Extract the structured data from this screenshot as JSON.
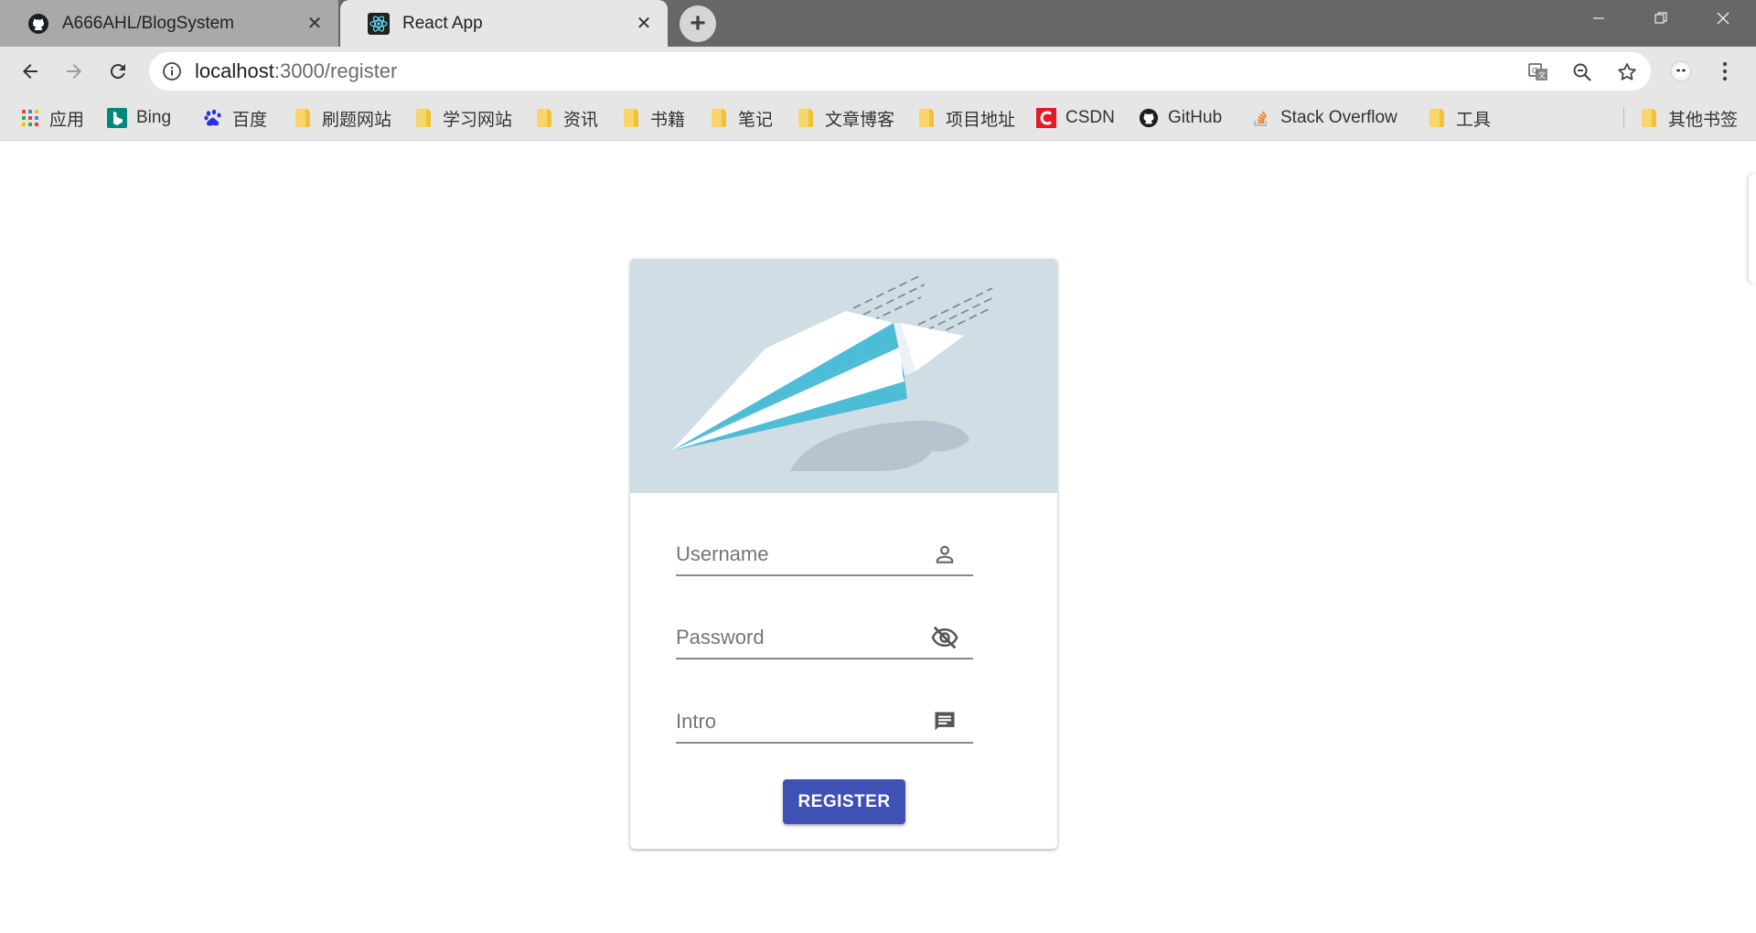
{
  "browser": {
    "tabs": [
      {
        "title": "A666AHL/BlogSystem",
        "favicon": "github-icon",
        "active": false
      },
      {
        "title": "React App",
        "favicon": "react-icon",
        "active": true
      }
    ],
    "url": {
      "host": "localhost",
      "path": ":3000/register"
    },
    "bookmarks": [
      {
        "label": "应用",
        "icon": "apps-grid-icon"
      },
      {
        "label": "Bing",
        "icon": "bing-icon"
      },
      {
        "label": "百度",
        "icon": "baidu-icon"
      },
      {
        "label": "刷题网站",
        "icon": "folder-icon"
      },
      {
        "label": "学习网站",
        "icon": "folder-icon"
      },
      {
        "label": "资讯",
        "icon": "folder-icon"
      },
      {
        "label": "书籍",
        "icon": "folder-icon"
      },
      {
        "label": "笔记",
        "icon": "folder-icon"
      },
      {
        "label": "文章博客",
        "icon": "folder-icon"
      },
      {
        "label": "项目地址",
        "icon": "folder-icon"
      },
      {
        "label": "CSDN",
        "icon": "csdn-icon"
      },
      {
        "label": "GitHub",
        "icon": "github-icon"
      },
      {
        "label": "Stack Overflow",
        "icon": "stackoverflow-icon"
      },
      {
        "label": "工具",
        "icon": "folder-icon"
      },
      {
        "label": "其他书签",
        "icon": "folder-icon"
      }
    ]
  },
  "register_form": {
    "fields": [
      {
        "label": "Username",
        "icon": "person-icon"
      },
      {
        "label": "Password",
        "icon": "visibility-off-icon"
      },
      {
        "label": "Intro",
        "icon": "chat-message-icon"
      }
    ],
    "submit_label": "REGISTER"
  },
  "colors": {
    "primary": "#3f51b5",
    "media_background": "#d0dde5",
    "plane_accent": "#4dbcd6"
  }
}
